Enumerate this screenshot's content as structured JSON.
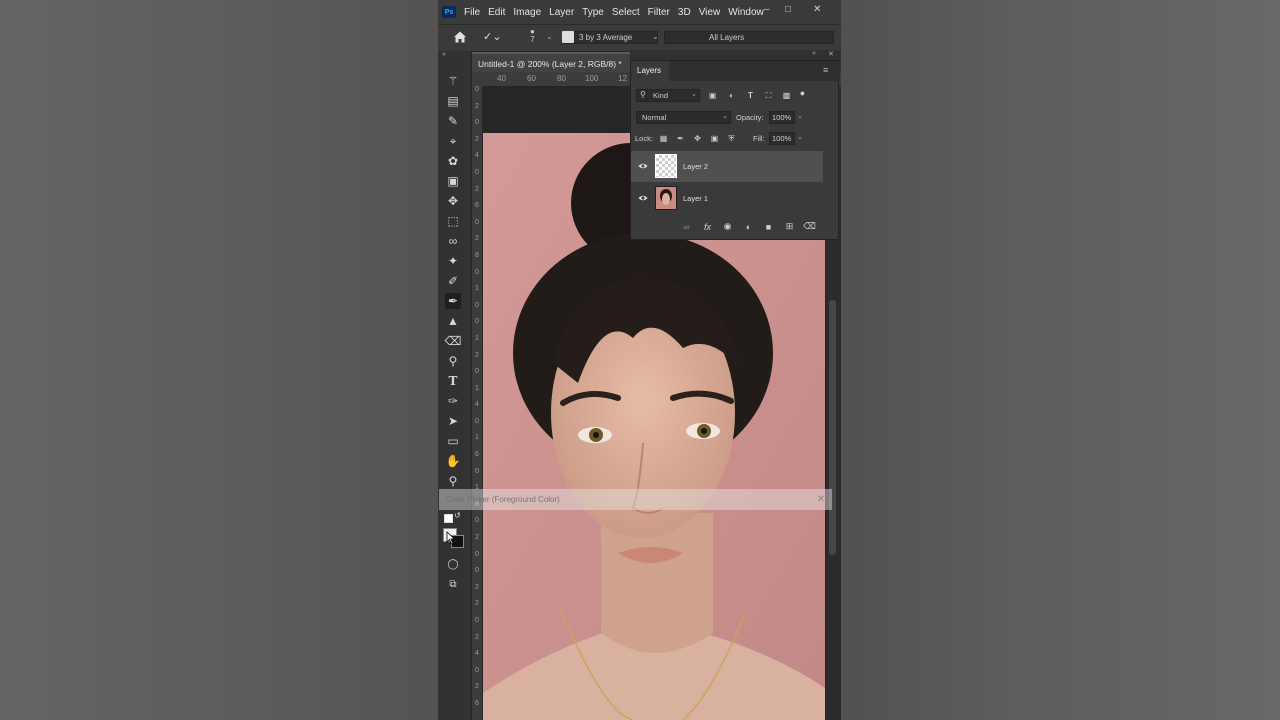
{
  "menubar": {
    "logo": "Ps",
    "items": [
      "File",
      "Edit",
      "Image",
      "Layer",
      "Type",
      "Select",
      "Filter",
      "3D",
      "View",
      "Window"
    ]
  },
  "options_bar": {
    "brush_size": "7",
    "sample_size": "3 by 3 Average",
    "sample_layers": "All Layers"
  },
  "document": {
    "tab_title": "Untitled-1 @ 200% (Layer 2, RGB/8) *",
    "ruler_h_ticks": [
      "40",
      "60",
      "80",
      "100",
      "12"
    ],
    "ruler_v_digits": [
      "0",
      "2",
      "0",
      "2",
      "4",
      "0",
      "2",
      "6",
      "0",
      "2",
      "8",
      "0",
      "1",
      "0",
      "0",
      "1",
      "2",
      "0",
      "1",
      "4",
      "0",
      "1",
      "6",
      "0",
      "1",
      "8",
      "0",
      "2",
      "0",
      "0",
      "2",
      "2",
      "0",
      "2",
      "4",
      "0",
      "2",
      "6"
    ]
  },
  "color_picker": {
    "title": "Color Picker (Foreground Color)"
  },
  "layers_panel": {
    "tab": "Layers",
    "filter_kind": "Kind",
    "blend_mode": "Normal",
    "opacity_label": "Opacity:",
    "opacity_value": "100%",
    "lock_label": "Lock:",
    "fill_label": "Fill:",
    "fill_value": "100%",
    "layers": [
      {
        "name": "Layer 2",
        "selected": true,
        "visible": true,
        "thumb": "transparent"
      },
      {
        "name": "Layer 1",
        "selected": false,
        "visible": true,
        "thumb": "photo"
      }
    ]
  },
  "colors": {
    "app_bg": "#323232",
    "canvas_pink": "#c88e8c",
    "selected_layer": "#505050"
  },
  "icons": {
    "toolbar": [
      "move-icon",
      "artboard-icon",
      "eyedropper-icon",
      "crop-icon",
      "spot-healing-icon",
      "frame-icon",
      "transform-icon",
      "marquee-icon",
      "lasso-icon",
      "magic-wand-icon",
      "color-sampler-icon",
      "brush-icon",
      "stamp-icon",
      "eraser-icon",
      "dodge-icon",
      "type-icon",
      "pen-icon",
      "path-select-icon",
      "rectangle-icon",
      "hand-icon",
      "zoom-icon"
    ]
  }
}
